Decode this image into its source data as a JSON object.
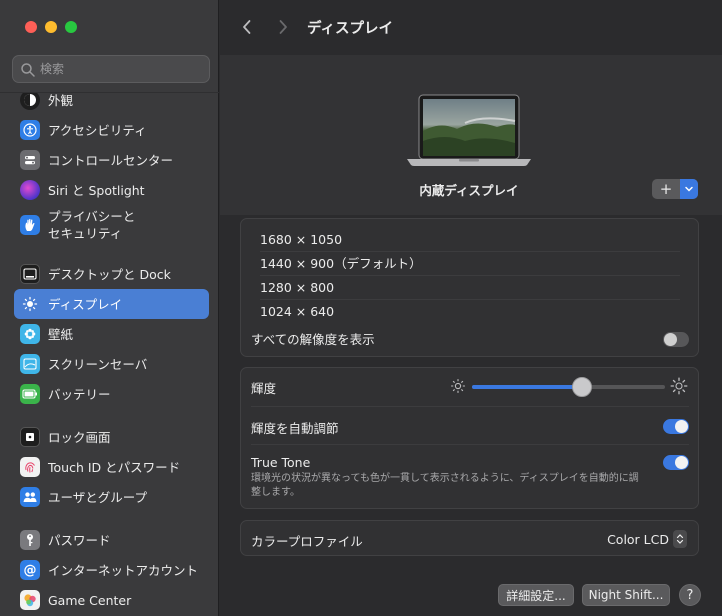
{
  "window": {
    "buttons": [
      {
        "name": "close",
        "color": "#fe5f57"
      },
      {
        "name": "minimize",
        "color": "#febc2e"
      },
      {
        "name": "zoom",
        "color": "#28c840"
      }
    ]
  },
  "search": {
    "placeholder": "検索",
    "value": ""
  },
  "sidebar": {
    "items": [
      {
        "label": "外観",
        "icon": "appearance-icon",
        "color": "#1e1e1e"
      },
      {
        "label": "アクセシビリティ",
        "icon": "accessibility-icon",
        "color": "#2f7ee6"
      },
      {
        "label": "コントロールセンター",
        "icon": "control-center-icon",
        "color": "#6c6c70"
      },
      {
        "label": "Siri と Spotlight",
        "icon": "siri-icon",
        "color": "#8b3bd6"
      },
      {
        "label": "プライバシーと\nセキュリティ",
        "icon": "privacy-hand-icon",
        "color": "#2f7ee6"
      },
      {
        "label": "デスクトップと Dock",
        "icon": "desktop-dock-icon",
        "color": "#1e1e1e"
      },
      {
        "label": "ディスプレイ",
        "icon": "display-sun-icon",
        "color": "#3a78e0",
        "selected": true
      },
      {
        "label": "壁紙",
        "icon": "wallpaper-icon",
        "color": "#3fb5e8"
      },
      {
        "label": "スクリーンセーバ",
        "icon": "screensaver-icon",
        "color": "#3fb5e8"
      },
      {
        "label": "バッテリー",
        "icon": "battery-icon",
        "color": "#3ab34a"
      },
      {
        "label": "ロック画面",
        "icon": "lock-screen-icon",
        "color": "#1e1e1e"
      },
      {
        "label": "Touch ID とパスワード",
        "icon": "fingerprint-icon",
        "color": "#f2f2f2"
      },
      {
        "label": "ユーザとグループ",
        "icon": "users-icon",
        "color": "#2f7ee6"
      },
      {
        "label": "パスワード",
        "icon": "key-icon",
        "color": "#7a7a7e"
      },
      {
        "label": "インターネットアカウント",
        "icon": "at-sign-icon",
        "color": "#2f7ee6"
      },
      {
        "label": "Game Center",
        "icon": "game-center-icon",
        "color": "#f2f2f2"
      }
    ]
  },
  "toolbar": {
    "title": "ディスプレイ"
  },
  "preview": {
    "display_name": "内蔵ディスプレイ",
    "add_label": "+"
  },
  "resolutions": {
    "options": [
      "1680 × 1050",
      "1440 × 900（デフォルト）",
      "1280 × 800",
      "1024 × 640"
    ],
    "show_all_label": "すべての解像度を表示",
    "show_all": false
  },
  "brightness": {
    "label": "輝度",
    "level": 0.57,
    "auto_label": "輝度を自動調節",
    "auto": true,
    "truetone_label": "True Tone",
    "truetone_desc": "環境光の状況が異なっても色が一貫して表示されるように、ディスプレイを自動的に調整します。",
    "truetone": true
  },
  "color_profile": {
    "label": "カラープロファイル",
    "value": "Color LCD"
  },
  "footer": {
    "advanced": "詳細設定...",
    "night_shift": "Night Shift...",
    "help": "?"
  },
  "colors": {
    "accent": "#3a78e0"
  }
}
